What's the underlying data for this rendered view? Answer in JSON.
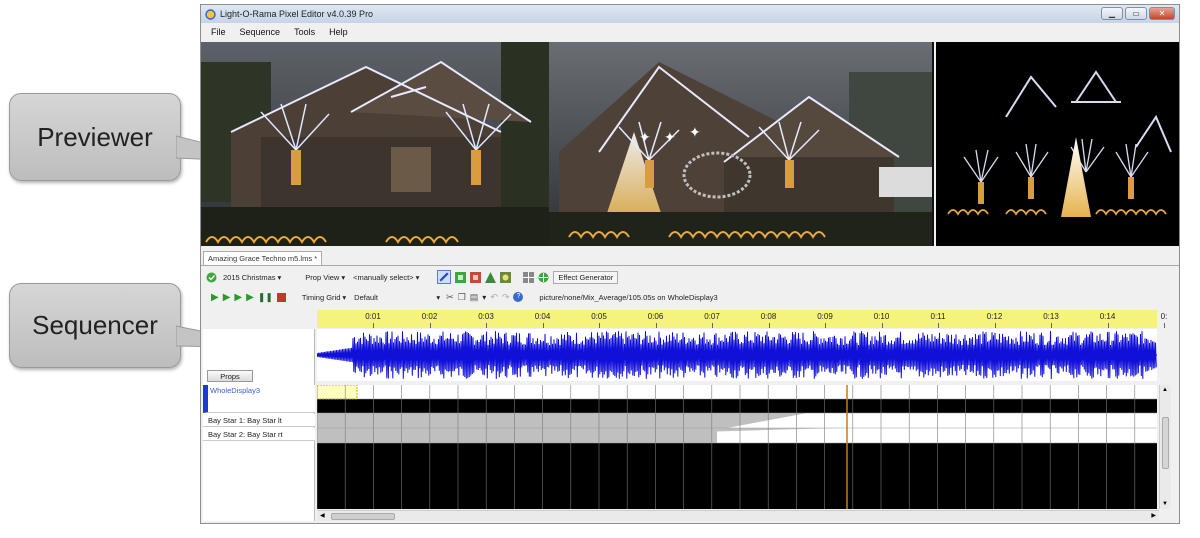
{
  "callouts": {
    "previewer": "Previewer",
    "sequencer": "Sequencer"
  },
  "window": {
    "title": "Light-O-Rama Pixel Editor v4.0.39 Pro"
  },
  "menu": {
    "items": [
      "File",
      "Sequence",
      "Tools",
      "Help"
    ]
  },
  "document": {
    "tab_label": "Amazing Grace Techno m5.lms *"
  },
  "toolbar": {
    "preview_select": "2015 Christmas",
    "prop_view_label": "Prop View",
    "prop_view_select": "<manually select>",
    "effect_generator": "Effect Generator",
    "timing_grid_label": "Timing Grid",
    "timing_grid_select": "Default",
    "status_text": "picture/none/Mix_Average/105.05s on WholeDisplay3"
  },
  "timeline": {
    "ticks": [
      "0:01",
      "0:02",
      "0:03",
      "0:04",
      "0:05",
      "0:06",
      "0:07",
      "0:08",
      "0:09",
      "0:10",
      "0:11",
      "0:12",
      "0:13",
      "0:14",
      "0:"
    ]
  },
  "props": {
    "button_label": "Props",
    "rows": [
      {
        "label": "WholeDisplay3"
      },
      {
        "label": "Bay Star 1: Bay Star lt"
      },
      {
        "label": "Bay Star 2: Bay Star rt"
      }
    ]
  },
  "colors": {
    "waveform": "#1010d8",
    "ruler": "#f6f37c",
    "selected_row": "#1a3ad0",
    "playhead": "#c87822"
  }
}
